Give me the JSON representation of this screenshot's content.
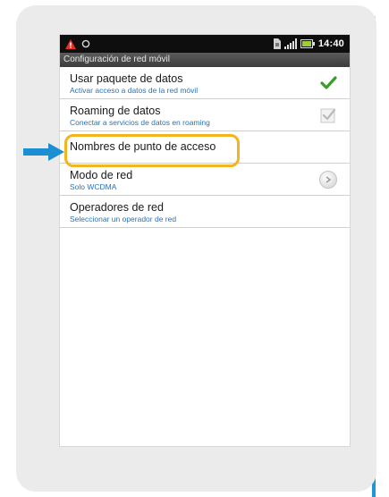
{
  "statusbar": {
    "time": "14:40",
    "icons": [
      "warning-icon",
      "circle-icon",
      "sim-icon",
      "signal-icon",
      "battery-icon"
    ]
  },
  "titlebar": {
    "title": "Configuración de red móvil"
  },
  "settings": [
    {
      "title": "Usar paquete de datos",
      "subtitle": "Activar acceso a datos de la red móvil",
      "control": "checkbox",
      "checked": true
    },
    {
      "title": "Roaming de datos",
      "subtitle": "Conectar a servicios de datos en roaming",
      "control": "checkbox",
      "checked": false
    },
    {
      "title": "Nombres de punto de acceso",
      "subtitle": "",
      "control": "none",
      "highlighted": true
    },
    {
      "title": "Modo de red",
      "subtitle": "Solo WCDMA",
      "control": "radio"
    },
    {
      "title": "Operadores de red",
      "subtitle": "Seleccionar un operador de red",
      "control": "none"
    }
  ],
  "colors": {
    "highlight": "#f4b321",
    "arrow": "#1b8fd2",
    "subtitle": "#2a73b8",
    "check": "#3a9c2a"
  }
}
